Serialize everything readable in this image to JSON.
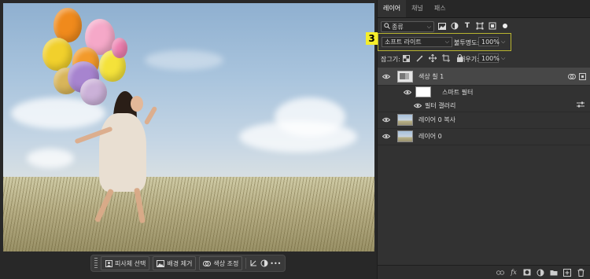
{
  "context_bar": {
    "select_subject": "피사체 선택",
    "remove_background": "배경 제거",
    "color_adjust": "색상 조정"
  },
  "panel": {
    "tabs": [
      {
        "label": "레이어"
      },
      {
        "label": "채널"
      },
      {
        "label": "패스"
      }
    ],
    "filter_kind": "종류",
    "blend_mode": "소프트 라이트",
    "opacity_label": "불투명도:",
    "opacity_value": "100%",
    "lock_label": "잠그기:",
    "fill_label": "채우기:",
    "fill_value": "100%",
    "annotation_number": "3",
    "layers": [
      {
        "name": "색상 칠 1"
      },
      {
        "name": "스마트 필터"
      },
      {
        "name": "필터 갤러리"
      },
      {
        "name": "레이어 0 복사"
      },
      {
        "name": "레이어 0"
      }
    ]
  },
  "colors": {
    "highlight": "#b9b530",
    "badge": "#f5ee2a",
    "panel_bg": "#323232"
  }
}
